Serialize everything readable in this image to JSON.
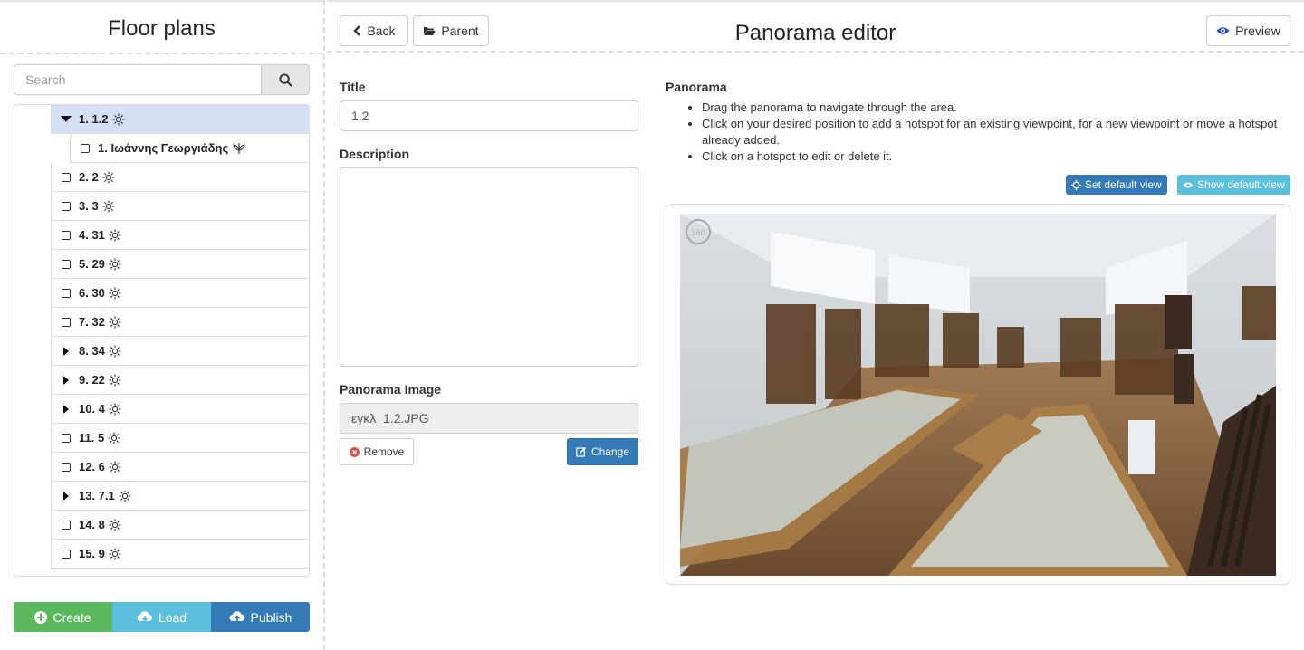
{
  "sidebar": {
    "title": "Floor plans",
    "search_placeholder": "Search",
    "tree": [
      {
        "label": "1. 1.2",
        "toggle": "expanded",
        "selected": true
      },
      {
        "label": "1. Ιωάννης Γεωργιάδης",
        "toggle": "checkbox",
        "child": true,
        "icon": "leaf"
      },
      {
        "label": "2. 2",
        "toggle": "checkbox"
      },
      {
        "label": "3. 3",
        "toggle": "checkbox"
      },
      {
        "label": "4. 31",
        "toggle": "checkbox"
      },
      {
        "label": "5. 29",
        "toggle": "checkbox"
      },
      {
        "label": "6. 30",
        "toggle": "checkbox"
      },
      {
        "label": "7. 32",
        "toggle": "checkbox"
      },
      {
        "label": "8. 34",
        "toggle": "collapsed"
      },
      {
        "label": "9. 22",
        "toggle": "collapsed"
      },
      {
        "label": "10. 4",
        "toggle": "collapsed"
      },
      {
        "label": "11. 5",
        "toggle": "checkbox"
      },
      {
        "label": "12. 6",
        "toggle": "checkbox"
      },
      {
        "label": "13. 7.1",
        "toggle": "collapsed"
      },
      {
        "label": "14. 8",
        "toggle": "checkbox"
      },
      {
        "label": "15. 9",
        "toggle": "checkbox"
      }
    ],
    "buttons": {
      "create": "Create",
      "load": "Load",
      "publish": "Publish"
    }
  },
  "header": {
    "back": "Back",
    "parent": "Parent",
    "title": "Panorama editor",
    "preview": "Preview"
  },
  "form": {
    "title_label": "Title",
    "title_value": "1.2",
    "description_label": "Description",
    "description_value": "",
    "image_label": "Panorama Image",
    "image_value": "εγκλ_1.2.JPG",
    "remove": "Remove",
    "change": "Change"
  },
  "panorama": {
    "heading": "Panorama",
    "instructions": [
      "Drag the panorama to navigate through the area.",
      "Click on your desired position to add a hotspot for an existing viewpoint, for a new viewpoint or move a hotspot already added.",
      "Click on a hotspot to edit or delete it."
    ],
    "set_default": "Set default view",
    "show_default": "Show default view"
  },
  "colors": {
    "selected_row": "#d6e0f5",
    "create": "#5cb85c",
    "load": "#5bc0de",
    "publish": "#337ab7",
    "preview_icon": "#2a4bd7",
    "remove_icon": "#d9534f"
  }
}
